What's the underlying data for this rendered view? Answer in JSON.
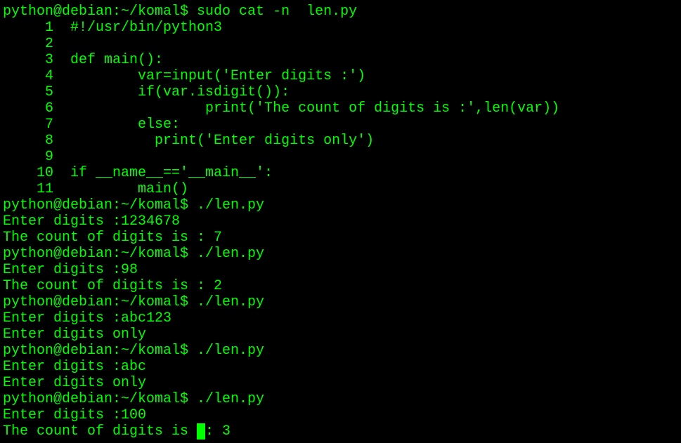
{
  "terminal": {
    "text_color": "#00ff00",
    "background_color": "#000000",
    "lines": [
      "python@debian:~/komal$ sudo cat -n  len.py",
      "     1  #!/usr/bin/python3",
      "     2",
      "     3  def main():",
      "     4          var=input('Enter digits :')",
      "     5          if(var.isdigit()):",
      "     6                  print('The count of digits is :',len(var))",
      "     7          else:",
      "     8            print('Enter digits only')",
      "     9",
      "    10  if __name__=='__main__':",
      "    11          main()",
      "python@debian:~/komal$ ./len.py",
      "Enter digits :1234678",
      "The count of digits is : 7",
      "python@debian:~/komal$ ./len.py",
      "Enter digits :98",
      "The count of digits is : 2",
      "python@debian:~/komal$ ./len.py",
      "Enter digits :abc123",
      "Enter digits only",
      "python@debian:~/komal$ ./len.py",
      "Enter digits :abc",
      "Enter digits only",
      "python@debian:~/komal$ ./len.py",
      "Enter digits :100"
    ],
    "last_line_before_cursor": "The count of digits is ",
    "last_line_after_cursor": ": 3"
  }
}
